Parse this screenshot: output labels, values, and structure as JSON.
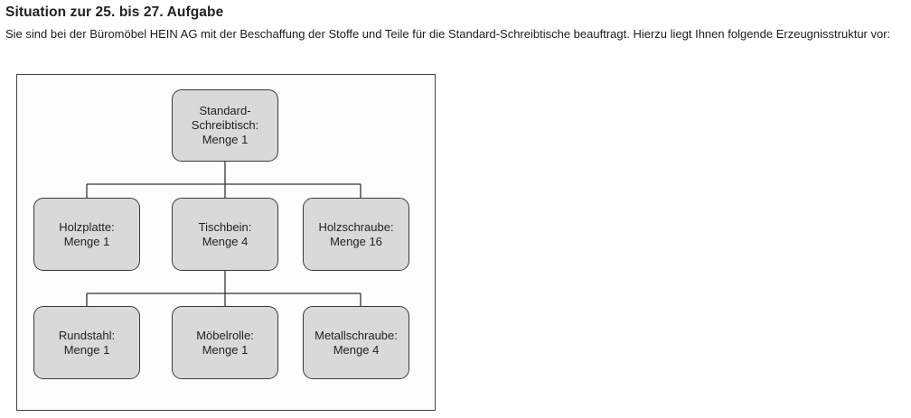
{
  "heading": "Situation zur 25. bis 27. Aufgabe",
  "intro": "Sie sind bei der Büromöbel HEIN AG mit der Beschaffung der Stoffe und Teile für die Standard-Schreibtische beauftragt. Hierzu liegt Ihnen folgende Erzeugnisstruktur vor:",
  "diagram": {
    "root": {
      "lines": [
        "Standard-",
        "Schreibtisch:",
        "Menge 1"
      ]
    },
    "level1": [
      {
        "lines": [
          "Holzplatte:",
          "Menge 1"
        ]
      },
      {
        "lines": [
          "Tischbein:",
          "Menge 4"
        ]
      },
      {
        "lines": [
          "Holzschraube:",
          "Menge 16"
        ]
      }
    ],
    "level2": [
      {
        "lines": [
          "Rundstahl:",
          "Menge 1"
        ]
      },
      {
        "lines": [
          "Möbelrolle:",
          "Menge 1"
        ]
      },
      {
        "lines": [
          "Metallschraube:",
          "Menge 4"
        ]
      }
    ]
  }
}
